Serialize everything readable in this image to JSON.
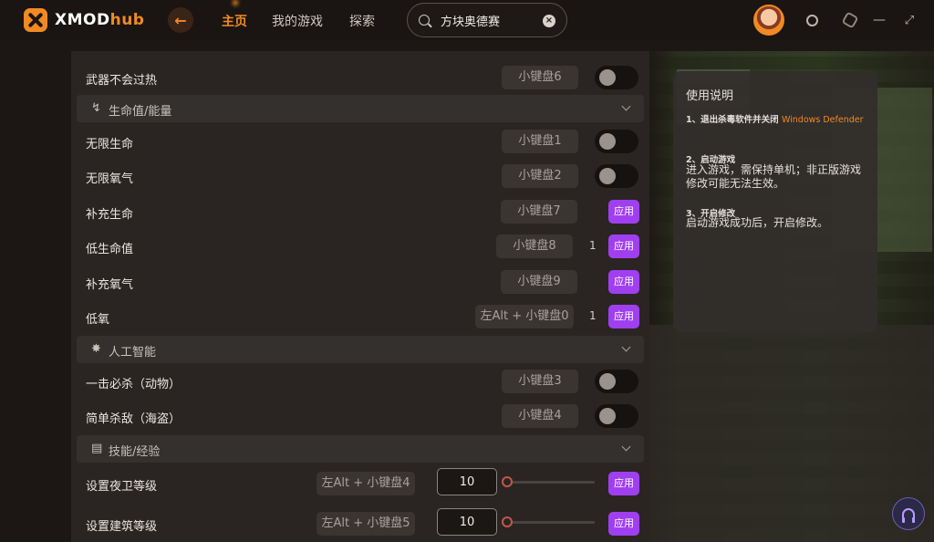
{
  "app": {
    "logo_text_main": "XMOD",
    "logo_text_accent": "hub",
    "accent_color": "#f08a24",
    "apply_color": "#a03ff0"
  },
  "nav": {
    "back_icon": "arrow-left-icon",
    "home": "主页",
    "my_games": "我的游戏",
    "explore": "探索"
  },
  "search": {
    "value": "方块奥德赛"
  },
  "sections": {
    "health": "生命值/能量",
    "ai": "人工智能",
    "skills": "技能/经验"
  },
  "cheats": [
    {
      "label": "武器不会过热",
      "hotkey": "小键盘6",
      "type": "toggle"
    },
    {
      "label": "无限生命",
      "hotkey": "小键盘1",
      "type": "toggle"
    },
    {
      "label": "无限氧气",
      "hotkey": "小键盘2",
      "type": "toggle"
    },
    {
      "label": "补充生命",
      "hotkey": "小键盘7",
      "type": "apply",
      "apply": "应用"
    },
    {
      "label": "低生命值",
      "hotkey": "小键盘8",
      "type": "apply",
      "value": "1",
      "apply": "应用"
    },
    {
      "label": "补充氧气",
      "hotkey": "小键盘9",
      "type": "apply",
      "apply": "应用"
    },
    {
      "label": "低氧",
      "hotkey": "左Alt + 小键盘0",
      "type": "apply",
      "value": "1",
      "apply": "应用"
    },
    {
      "label": "一击必杀（动物）",
      "hotkey": "小键盘3",
      "type": "toggle"
    },
    {
      "label": "简单杀敌（海盗）",
      "hotkey": "小键盘4",
      "type": "toggle"
    },
    {
      "label": "设置夜卫等级",
      "hotkey": "左Alt + 小键盘4",
      "type": "slider",
      "value": "10",
      "slider_level": 0.0,
      "apply": "应用"
    },
    {
      "label": "设置建筑等级",
      "hotkey": "左Alt + 小键盘5",
      "type": "slider",
      "value": "10",
      "slider_level": 0.0,
      "apply": "应用"
    }
  ],
  "help": {
    "title": "使用说明",
    "step1_head": "1、退出杀毒软件并关闭",
    "step1_highlight": "Windows Defender",
    "step2_head": "2、启动游戏",
    "step2_body": "进入游戏，需保持单机；非正版游戏修改可能无法生效。",
    "step3_head": "3、开启修改",
    "step3_body": "启动游戏成功后，开启修改。"
  }
}
